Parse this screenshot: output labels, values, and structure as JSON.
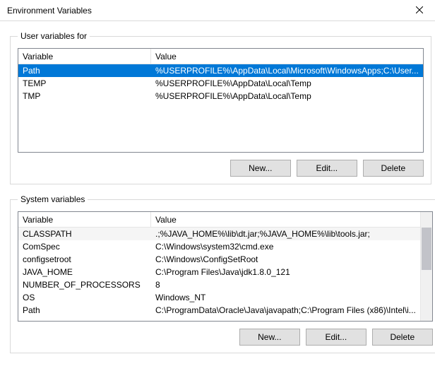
{
  "window": {
    "title": "Environment Variables"
  },
  "userGroup": {
    "legend": "User variables for",
    "headers": {
      "variable": "Variable",
      "value": "Value"
    },
    "rows": [
      {
        "variable": "Path",
        "value": "%USERPROFILE%\\AppData\\Local\\Microsoft\\WindowsApps;C:\\User..."
      },
      {
        "variable": "TEMP",
        "value": "%USERPROFILE%\\AppData\\Local\\Temp"
      },
      {
        "variable": "TMP",
        "value": "%USERPROFILE%\\AppData\\Local\\Temp"
      }
    ],
    "buttons": {
      "new": "New...",
      "edit": "Edit...",
      "delete": "Delete"
    }
  },
  "systemGroup": {
    "legend": "System variables",
    "headers": {
      "variable": "Variable",
      "value": "Value"
    },
    "rows": [
      {
        "variable": "CLASSPATH",
        "value": ".;%JAVA_HOME%\\lib\\dt.jar;%JAVA_HOME%\\lib\\tools.jar;"
      },
      {
        "variable": "ComSpec",
        "value": "C:\\Windows\\system32\\cmd.exe"
      },
      {
        "variable": "configsetroot",
        "value": "C:\\Windows\\ConfigSetRoot"
      },
      {
        "variable": "JAVA_HOME",
        "value": "C:\\Program Files\\Java\\jdk1.8.0_121"
      },
      {
        "variable": "NUMBER_OF_PROCESSORS",
        "value": "8"
      },
      {
        "variable": "OS",
        "value": "Windows_NT"
      },
      {
        "variable": "Path",
        "value": "C:\\ProgramData\\Oracle\\Java\\javapath;C:\\Program Files (x86)\\Intel\\i..."
      }
    ],
    "buttons": {
      "new": "New...",
      "edit": "Edit...",
      "delete": "Delete"
    }
  }
}
